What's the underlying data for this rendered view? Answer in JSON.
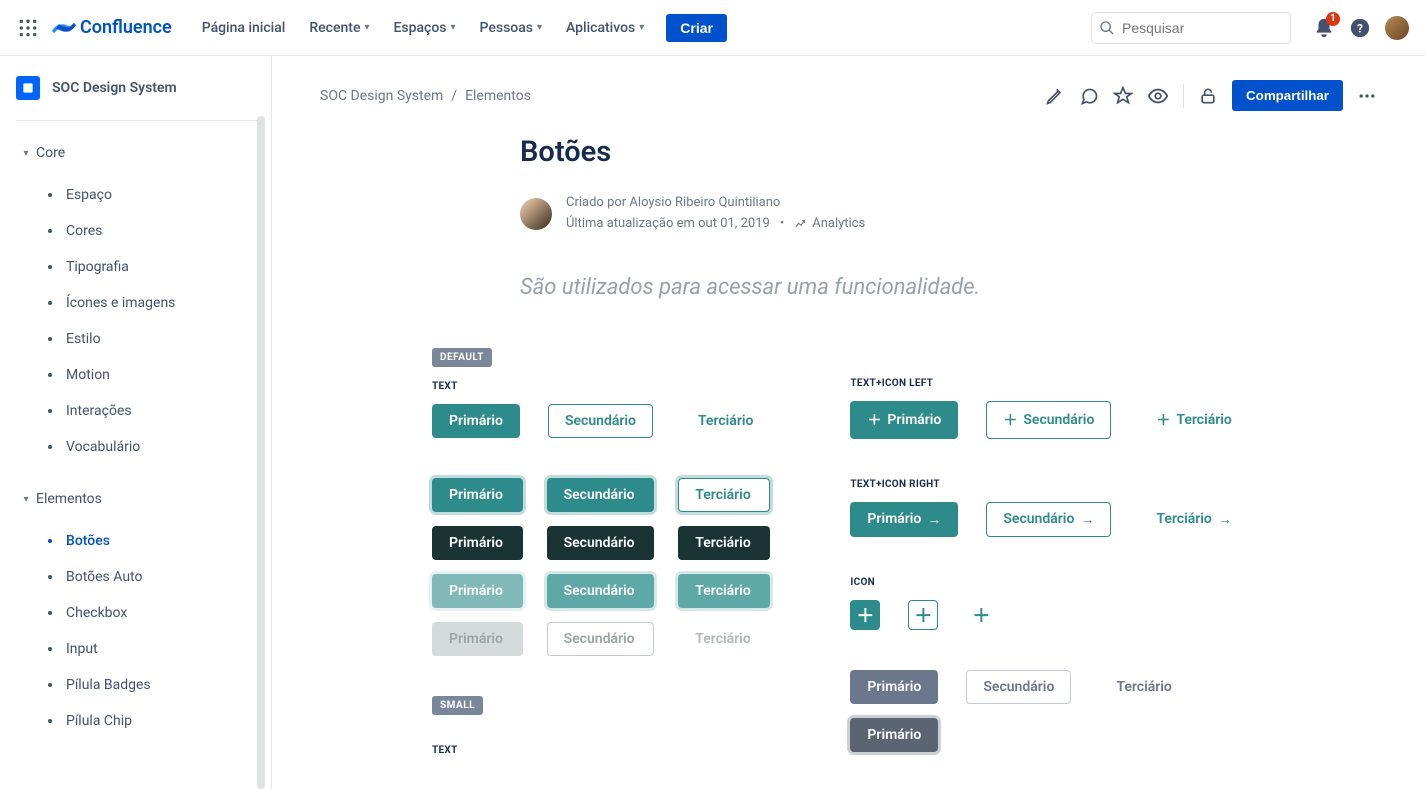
{
  "topnav": {
    "product": "Confluence",
    "links": {
      "home": "Página inicial",
      "recent": "Recente",
      "spaces": "Espaços",
      "people": "Pessoas",
      "apps": "Aplicativos"
    },
    "create": "Criar",
    "searchPlaceholder": "Pesquisar",
    "notifications": "1"
  },
  "sidebar": {
    "spaceName": "SOC Design System",
    "groups": [
      {
        "label": "Core",
        "items": [
          "Espaço",
          "Cores",
          "Tipografia",
          "Ícones e imagens",
          "Estilo",
          "Motion",
          "Interações",
          "Vocabulário"
        ]
      },
      {
        "label": "Elementos",
        "items": [
          "Botões",
          "Botões Auto",
          "Checkbox",
          "Input",
          "Pílula Badges",
          "Pílula Chip"
        ],
        "activeIndex": 0
      }
    ]
  },
  "breadcrumbs": {
    "space": "SOC Design System",
    "parent": "Elementos"
  },
  "page": {
    "title": "Botões",
    "createdByPrefix": "Criado por ",
    "author": "Aloysio Ribeiro Quintiliano",
    "updatedPrefix": "Última atualização em ",
    "updatedDate": "out 01, 2019",
    "analytics": "Analytics",
    "share": "Compartilhar",
    "intro": "São utilizados para acessar uma funcionalidade."
  },
  "ex": {
    "default": "DEFAULT",
    "small": "SMALL",
    "text": "TEXT",
    "textIconLeft": "TEXT+ICON LEFT",
    "textIconRight": "TEXT+ICON RIGHT",
    "icon": "ICON",
    "primary": "Primário",
    "secondary": "Secundário",
    "tertiary": "Terciário"
  }
}
